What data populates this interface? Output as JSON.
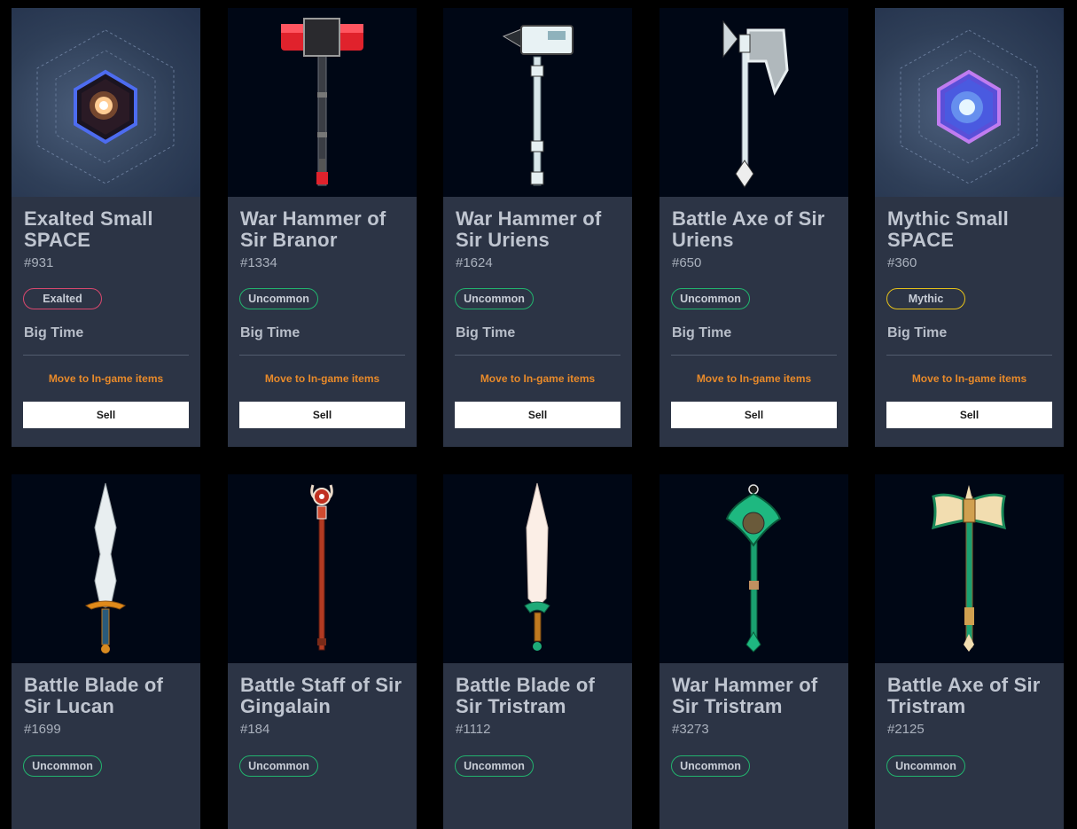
{
  "cards": [
    {
      "title": "Exalted Small SPACE",
      "number": "#931",
      "rarity": "Exalted",
      "game": "Big Time",
      "move_label": "Move to In-game items",
      "sell_label": "Sell",
      "icon": "space-cube-icon"
    },
    {
      "title": "War Hammer of Sir Branor",
      "number": "#1334",
      "rarity": "Uncommon",
      "game": "Big Time",
      "move_label": "Move to In-game items",
      "sell_label": "Sell",
      "icon": "war-hammer-icon"
    },
    {
      "title": "War Hammer of Sir Uriens",
      "number": "#1624",
      "rarity": "Uncommon",
      "game": "Big Time",
      "move_label": "Move to In-game items",
      "sell_label": "Sell",
      "icon": "war-hammer-icon"
    },
    {
      "title": "Battle Axe of Sir Uriens",
      "number": "#650",
      "rarity": "Uncommon",
      "game": "Big Time",
      "move_label": "Move to In-game items",
      "sell_label": "Sell",
      "icon": "battle-axe-icon"
    },
    {
      "title": "Mythic Small SPACE",
      "number": "#360",
      "rarity": "Mythic",
      "game": "Big Time",
      "move_label": "Move to In-game items",
      "sell_label": "Sell",
      "icon": "space-cube-icon"
    },
    {
      "title": "Battle Blade of Sir Lucan",
      "number": "#1699",
      "rarity": "Uncommon",
      "icon": "battle-blade-icon"
    },
    {
      "title": "Battle Staff of Sir Gingalain",
      "number": "#184",
      "rarity": "Uncommon",
      "icon": "battle-staff-icon"
    },
    {
      "title": "Battle Blade of Sir Tristram",
      "number": "#1112",
      "rarity": "Uncommon",
      "icon": "battle-blade-icon"
    },
    {
      "title": "War Hammer of Sir Tristram",
      "number": "#3273",
      "rarity": "Uncommon",
      "icon": "war-hammer-icon"
    },
    {
      "title": "Battle Axe of Sir Tristram",
      "number": "#2125",
      "rarity": "Uncommon",
      "icon": "battle-axe-icon"
    }
  ],
  "colors": {
    "card_bg": "#2c3445",
    "art_bg": "#000715",
    "exalted": "#d9486e",
    "uncommon": "#22b46e",
    "mythic": "#e6c21a",
    "move_link": "#e88a2a"
  }
}
